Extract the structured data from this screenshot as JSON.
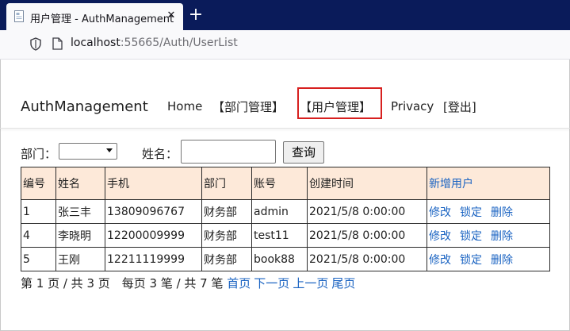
{
  "browser": {
    "tab_title": "用户管理 - AuthManagement",
    "url_host": "localhost",
    "url_rest": ":55665/Auth/UserList"
  },
  "nav": {
    "brand": "AuthManagement",
    "items": [
      {
        "label": "Home"
      },
      {
        "label": "【部门管理】"
      },
      {
        "label": "【用户管理】"
      },
      {
        "label": "Privacy"
      },
      {
        "label": "[登出]"
      }
    ]
  },
  "search": {
    "dept_label": "部门：",
    "dept_selected": "",
    "name_label": "姓名：",
    "name_value": "",
    "submit": "查询"
  },
  "table": {
    "headers": [
      "编号",
      "姓名",
      "手机",
      "部门",
      "账号",
      "创建时间"
    ],
    "add_user": "新增用户",
    "rows": [
      {
        "id": "1",
        "name": "张三丰",
        "phone": "13809096767",
        "dept": "财务部",
        "account": "admin",
        "created": "2021/5/8 0:00:00"
      },
      {
        "id": "4",
        "name": "李晓明",
        "phone": "12200009999",
        "dept": "财务部",
        "account": "test11",
        "created": "2021/5/8 0:00:00"
      },
      {
        "id": "5",
        "name": "王刚",
        "phone": "12211119999",
        "dept": "财务部",
        "account": "book88",
        "created": "2021/5/8 0:00:00"
      }
    ],
    "actions": {
      "edit": "修改",
      "lock": "锁定",
      "delete": "删除"
    }
  },
  "pager": {
    "summary": "第 1 页 / 共 3 页　每页 3 笔 / 共 7 笔",
    "first": "首页",
    "next": "下一页",
    "prev": "上一页",
    "last": "尾页"
  }
}
